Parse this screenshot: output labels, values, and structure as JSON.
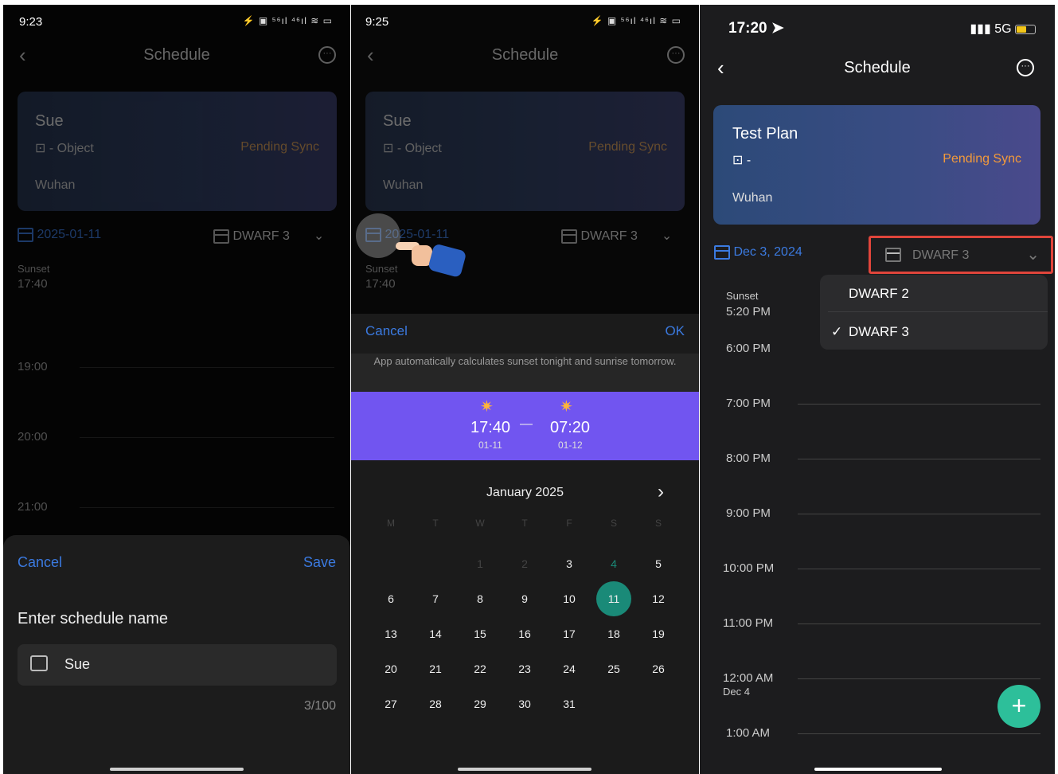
{
  "p1": {
    "status": {
      "time": "9:23",
      "icons": "⚡ ▣ ⁵⁶ıl ⁴⁶ıl ≋ ▭"
    },
    "header": {
      "back": "‹",
      "title": "Schedule",
      "more": "···"
    },
    "card": {
      "name": "Sue",
      "object": "- Object",
      "sync": "Pending Sync",
      "location": "Wuhan"
    },
    "date": "2025-01-11",
    "device": "DWARF 3",
    "sunset_label": "Sunset",
    "sunset_time": "17:40",
    "hours": [
      "19:00",
      "20:00",
      "21:00"
    ],
    "sheet": {
      "cancel": "Cancel",
      "save": "Save",
      "prompt": "Enter schedule name",
      "value": "Sue",
      "counter": "3/100"
    }
  },
  "p2": {
    "status": {
      "time": "9:25",
      "icons": "⚡ ▣ ⁵⁶ıl ⁴⁶ıl ≋ ▭"
    },
    "header": {
      "back": "‹",
      "title": "Schedule",
      "more": "···"
    },
    "card": {
      "name": "Sue",
      "object": "- Object",
      "sync": "Pending Sync",
      "location": "Wuhan"
    },
    "date": "2025-01-11",
    "device": "DWARF 3",
    "sunset_label": "Sunset",
    "sunset_time": "17:40",
    "picker": {
      "cancel": "Cancel",
      "ok": "OK",
      "note": "App automatically calculates sunset tonight and sunrise tomorrow.",
      "start_time": "17:40",
      "start_date": "01-11",
      "dash": "—",
      "end_time": "07:20",
      "end_date": "01-12",
      "month": "January 2025",
      "next": "›",
      "weekdays": [
        "M",
        "T",
        "W",
        "T",
        "F",
        "S",
        "S"
      ],
      "weeks": [
        [
          "",
          "",
          "1",
          "2",
          "3",
          "4",
          "5"
        ],
        [
          "6",
          "7",
          "8",
          "9",
          "10",
          "11",
          "12"
        ],
        [
          "13",
          "14",
          "15",
          "16",
          "17",
          "18",
          "19"
        ],
        [
          "20",
          "21",
          "22",
          "23",
          "24",
          "25",
          "26"
        ],
        [
          "27",
          "28",
          "29",
          "30",
          "31",
          "",
          ""
        ]
      ],
      "selected": "11"
    }
  },
  "p3": {
    "status": {
      "time": "17:20",
      "signal": "5G"
    },
    "header": {
      "back": "‹",
      "title": "Schedule",
      "more": "···"
    },
    "card": {
      "name": "Test Plan",
      "object": "-",
      "sync": "Pending Sync",
      "location": "Wuhan"
    },
    "date": "Dec 3, 2024",
    "device": "DWARF 3",
    "dropdown": [
      {
        "label": "DWARF 2",
        "checked": false
      },
      {
        "label": "DWARF 3",
        "checked": true
      }
    ],
    "sunset_label": "Sunset",
    "sunset_time": "5:20 PM",
    "hours": [
      "6:00 PM",
      "7:00 PM",
      "8:00 PM",
      "9:00 PM",
      "10:00 PM",
      "11:00 PM",
      "12:00 AM",
      "1:00 AM"
    ],
    "next_day": "Dec 4",
    "fab": "+"
  },
  "colors": {
    "accent_blue": "#3b7ae0",
    "pending": "#d9a05b",
    "picker_band": "#7155f0",
    "selected_day": "#1a8a78",
    "fab": "#2dbf9a",
    "highlight_box": "#e0453b"
  }
}
